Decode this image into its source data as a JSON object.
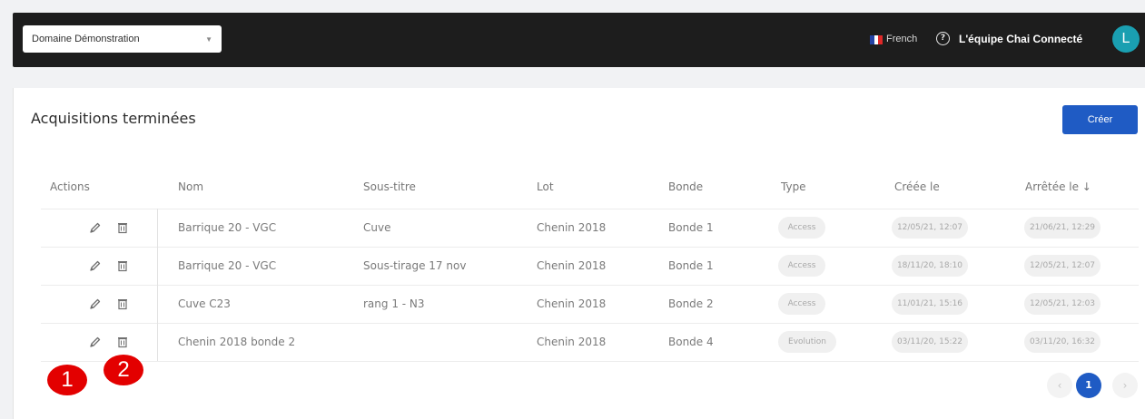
{
  "header": {
    "domain_select": "Domaine Démonstration",
    "language": "French",
    "help_icon": "?",
    "team_name": "L'équipe Chai Connecté",
    "avatar_letter": "L"
  },
  "page": {
    "title": "Acquisitions terminées",
    "create_button": "Créer"
  },
  "table": {
    "columns": [
      "Actions",
      "Nom",
      "Sous-titre",
      "Lot",
      "Bonde",
      "Type",
      "Créée le",
      "Arrêtée le ↓"
    ],
    "rows": [
      {
        "nom": "Barrique 20 - VGC",
        "sous_titre": "Cuve",
        "lot": "Chenin 2018",
        "bonde": "Bonde 1",
        "type": "Access",
        "creee": "12/05/21, 12:07",
        "arretee": "21/06/21, 12:29"
      },
      {
        "nom": "Barrique 20 - VGC",
        "sous_titre": "Sous-tirage 17 nov",
        "lot": "Chenin 2018",
        "bonde": "Bonde 1",
        "type": "Access",
        "creee": "18/11/20, 18:10",
        "arretee": "12/05/21, 12:07"
      },
      {
        "nom": "Cuve C23",
        "sous_titre": "rang 1 - N3",
        "lot": "Chenin 2018",
        "bonde": "Bonde 2",
        "type": "Access",
        "creee": "11/01/21, 15:16",
        "arretee": "12/05/21, 12:03"
      },
      {
        "nom": "Chenin 2018 bonde 2",
        "sous_titre": "",
        "lot": "Chenin 2018",
        "bonde": "Bonde 4",
        "type": "Evolution",
        "creee": "03/11/20, 15:22",
        "arretee": "03/11/20, 16:32"
      }
    ]
  },
  "pagination": {
    "prev": "‹",
    "current": "1",
    "next": "›"
  },
  "annotations": {
    "marker_1": "1",
    "marker_2": "2"
  },
  "colors": {
    "topbar": "#1d1d1d",
    "primary": "#1f5bc4",
    "avatar": "#1a9fb1",
    "marker": "#e30000"
  }
}
